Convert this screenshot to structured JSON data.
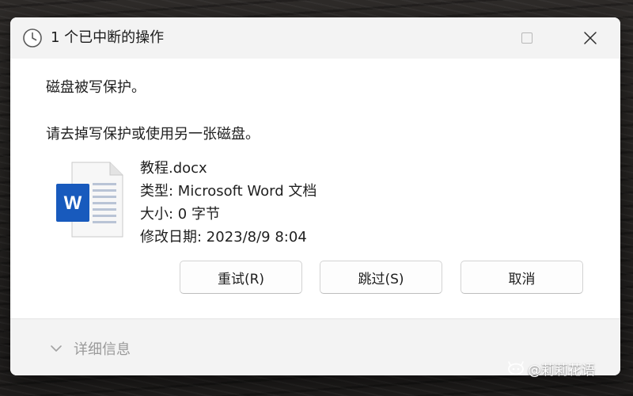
{
  "window": {
    "title": "1 个已中断的操作",
    "icon": "clock-icon"
  },
  "message": {
    "line1": "磁盘被写保护。",
    "line2": "请去掉写保护或使用另一张磁盘。"
  },
  "file": {
    "icon": "word-document-icon",
    "icon_letter": "W",
    "name": "教程.docx",
    "type": "类型: Microsoft Word 文档",
    "size": "大小: 0 字节",
    "modified": "修改日期: 2023/8/9 8:04"
  },
  "buttons": {
    "retry": "重试(R)",
    "skip": "跳过(S)",
    "cancel": "取消"
  },
  "footer": {
    "details_label": "详细信息"
  },
  "watermark": {
    "text": "@莉莉花语"
  },
  "colors": {
    "word_blue": "#185abd",
    "titlebar_bg": "#f3f3f3",
    "dialog_bg": "#ffffff"
  }
}
